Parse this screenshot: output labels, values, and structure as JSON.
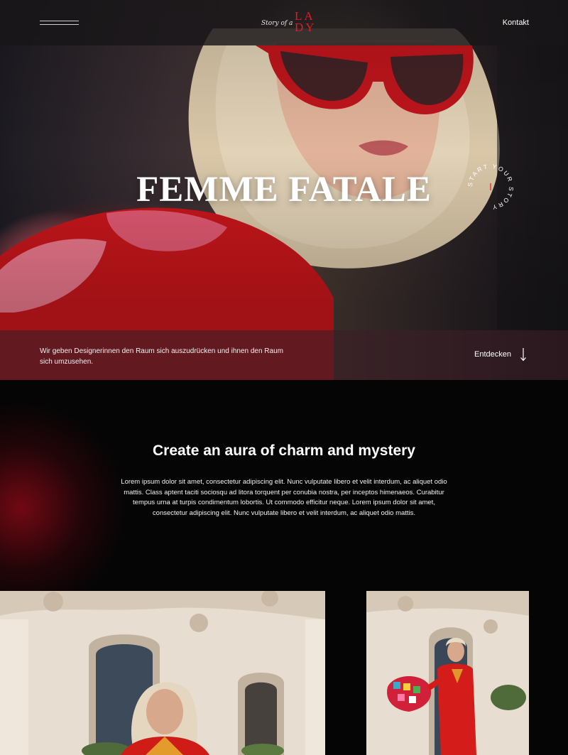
{
  "header": {
    "logo_script": "Story of a",
    "logo_mark_top": "LA",
    "logo_mark_bottom": "DY",
    "contact_label": "Kontakt",
    "menu_icon": "menu-icon"
  },
  "hero": {
    "title": "FEMME FATALE",
    "badge_text": "START YOUR STORY",
    "tagline": "Wir geben Designerinnen den Raum sich auszudrücken und ihnen den Raum sich umzusehen.",
    "discover_label": "Entdecken",
    "discover_icon": "arrow-down-icon"
  },
  "intro": {
    "title": "Create an aura of charm and mystery",
    "body": "Lorem ipsum dolor sit amet, consectetur adipiscing elit. Nunc vulputate libero et velit interdum, ac aliquet odio mattis. Class aptent taciti sociosqu ad litora torquent per conubia nostra, per inceptos himenaeos. Curabitur tempus urna at turpis condimentum lobortis. Ut commodo efficitur neque. Lorem ipsum dolor sit amet, consectetur adipiscing elit. Nunc vulputate libero et velit interdum, ac aliquet odio mattis."
  },
  "colors": {
    "accent_red": "#e31b23",
    "background": "#050505"
  }
}
